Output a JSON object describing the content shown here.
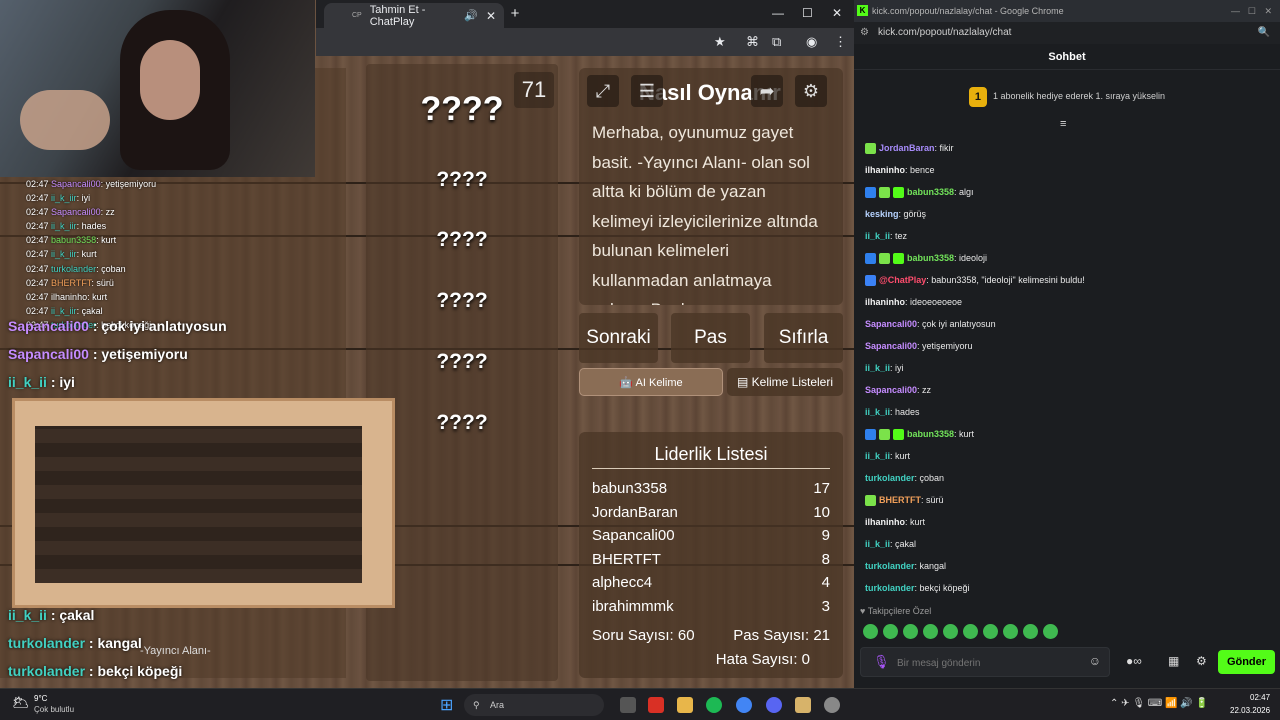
{
  "browser": {
    "tab_title": "Tahmin Et - ChatPlay",
    "tab_favicon": "CP"
  },
  "small_chat": [
    {
      "time": "02:47",
      "user": "Sapancali00",
      "color": "purple",
      "text": "yetişemiyoru"
    },
    {
      "time": "02:47",
      "user": "ii_k_iir",
      "color": "teal",
      "text": "iyi"
    },
    {
      "time": "02:47",
      "user": "Sapancali00",
      "color": "purple",
      "text": "zz"
    },
    {
      "time": "02:47",
      "user": "ii_k_iir",
      "color": "teal",
      "text": "hades"
    },
    {
      "time": "02:47",
      "user": "babun3358",
      "color": "green",
      "text": "kurt"
    },
    {
      "time": "02:47",
      "user": "ii_k_iir",
      "color": "teal",
      "text": "kurt"
    },
    {
      "time": "02:47",
      "user": "turkolander",
      "color": "teal",
      "text": "çoban"
    },
    {
      "time": "02:47",
      "user": "BHERTFT",
      "color": "orange",
      "text": "sürü"
    },
    {
      "time": "02:47",
      "user": "ilhaninho",
      "color": "white",
      "text": "kurt"
    },
    {
      "time": "02:47",
      "user": "ii_k_iir",
      "color": "teal",
      "text": "çakal"
    },
    {
      "time": "02:47",
      "user": "turkolander",
      "color": "teal",
      "text": "bekçi köpeği"
    }
  ],
  "big_chat": [
    {
      "user": "Sapancali00",
      "color": "purple",
      "text": ": çok iyi anlatıyosun"
    },
    {
      "user": "Sapancali00",
      "color": "purple",
      "text": ": yetişemiyoru"
    },
    {
      "user": "ii_k_ii",
      "color": "teal",
      "text": ": iyi"
    },
    {
      "user": "ii_k_ii",
      "color": "teal",
      "text": ": çakal"
    },
    {
      "user": "turkolander",
      "color": "teal",
      "text": ": kangal"
    },
    {
      "user": "turkolander",
      "color": "teal",
      "text": ": bekçi köpeği"
    }
  ],
  "game": {
    "counter": "71",
    "words": [
      "????",
      "????",
      "????",
      "????",
      "????",
      "????"
    ],
    "howto_title": "Nasıl Oynanır",
    "howto_text": "Merhaba, oyunumuz gayet basit. -Yayıncı Alanı- olan sol altta ki bölüm de yazan kelimeyi izleyicilerinize altında bulunan kelimeleri kullanmadan anlatmaya çalışın. Bunlar",
    "buttons": {
      "next": "Sonraki",
      "pass": "Pas",
      "reset": "Sıfırla",
      "ai_word": "AI Kelime",
      "word_lists": "Kelime Listeleri"
    },
    "streamer_area": "-Yayıncı Alanı-",
    "leaderboard_title": "Liderlik Listesi",
    "leaderboard": [
      {
        "name": "babun3358",
        "score": "17"
      },
      {
        "name": "JordanBaran",
        "score": "10"
      },
      {
        "name": "Sapancali00",
        "score": "9"
      },
      {
        "name": "BHERTFT",
        "score": "8"
      },
      {
        "name": "alphecc4",
        "score": "4"
      },
      {
        "name": "ibrahimmmk",
        "score": "3"
      }
    ],
    "question_count": "Soru Sayısı: 60",
    "pass_count": "Pas Sayısı: 21",
    "error_count": "Hata Sayısı: 0"
  },
  "chat_window": {
    "title": "kick.com/popout/nazlalay/chat - Google Chrome",
    "url": "kick.com/popout/nazlalay/chat",
    "header": "Sohbet",
    "promo_rank": "1",
    "promo": "1 abonelik hediye ederek 1. sıraya yükselin",
    "messages": [
      {
        "badges": [
          "sparkle"
        ],
        "user": "JordanBaran",
        "color": "#a78bfa",
        "text": ": fikir"
      },
      {
        "badges": [],
        "user": "ilhaninho",
        "color": "#f2f2f2",
        "text": ": bence"
      },
      {
        "badges": [
          "blue",
          "sparkle",
          "gift"
        ],
        "user": "babun3358",
        "color": "#72e35a",
        "text": ": algı"
      },
      {
        "badges": [],
        "user": "kesking",
        "color": "#b7d3ff",
        "text": ": görüş"
      },
      {
        "badges": [],
        "user": "ii_k_ii",
        "color": "#41d1c2",
        "text": ": tez"
      },
      {
        "badges": [
          "blue",
          "sparkle",
          "gift"
        ],
        "user": "babun3358",
        "color": "#72e35a",
        "text": ": ideoloji"
      },
      {
        "badges": [
          "bot"
        ],
        "user": "@ChatPlay",
        "color": "#ff4d6d",
        "text": ": babun3358, \"ideoloji\" kelimesini buldu!"
      },
      {
        "badges": [],
        "user": "ilhaninho",
        "color": "#f2f2f2",
        "text": ": ideoeoeoeoe"
      },
      {
        "badges": [],
        "user": "Sapancali00",
        "color": "#c58cff",
        "text": ": çok iyi anlatıyosun"
      },
      {
        "badges": [],
        "user": "Sapancali00",
        "color": "#c58cff",
        "text": ": yetişemiyoru"
      },
      {
        "badges": [],
        "user": "ii_k_ii",
        "color": "#41d1c2",
        "text": ": iyi"
      },
      {
        "badges": [],
        "user": "Sapancali00",
        "color": "#c58cff",
        "text": ": zz"
      },
      {
        "badges": [],
        "user": "ii_k_ii",
        "color": "#41d1c2",
        "text": ": hades"
      },
      {
        "badges": [
          "blue",
          "sparkle",
          "gift"
        ],
        "user": "babun3358",
        "color": "#72e35a",
        "text": ": kurt"
      },
      {
        "badges": [],
        "user": "ii_k_ii",
        "color": "#41d1c2",
        "text": ": kurt"
      },
      {
        "badges": [],
        "user": "turkolander",
        "color": "#41d1c2",
        "text": ": çoban"
      },
      {
        "badges": [
          "sparkle"
        ],
        "user": "BHERTFT",
        "color": "#f2a05a",
        "text": ": sürü"
      },
      {
        "badges": [],
        "user": "ilhaninho",
        "color": "#f2f2f2",
        "text": ": kurt"
      },
      {
        "badges": [],
        "user": "ii_k_ii",
        "color": "#41d1c2",
        "text": ": çakal"
      },
      {
        "badges": [],
        "user": "turkolander",
        "color": "#41d1c2",
        "text": ": kangal"
      },
      {
        "badges": [],
        "user": "turkolander",
        "color": "#41d1c2",
        "text": ": bekçi köpeği"
      }
    ],
    "followers_only": "Takipçilere Özel",
    "input_placeholder": "Bir mesaj gönderin",
    "send": "Gönder"
  },
  "taskbar": {
    "weather_temp": "9°C",
    "weather_desc": "Çok bulutlu",
    "search_placeholder": "Ara",
    "time": "02:47",
    "date": "22.03.2026"
  }
}
